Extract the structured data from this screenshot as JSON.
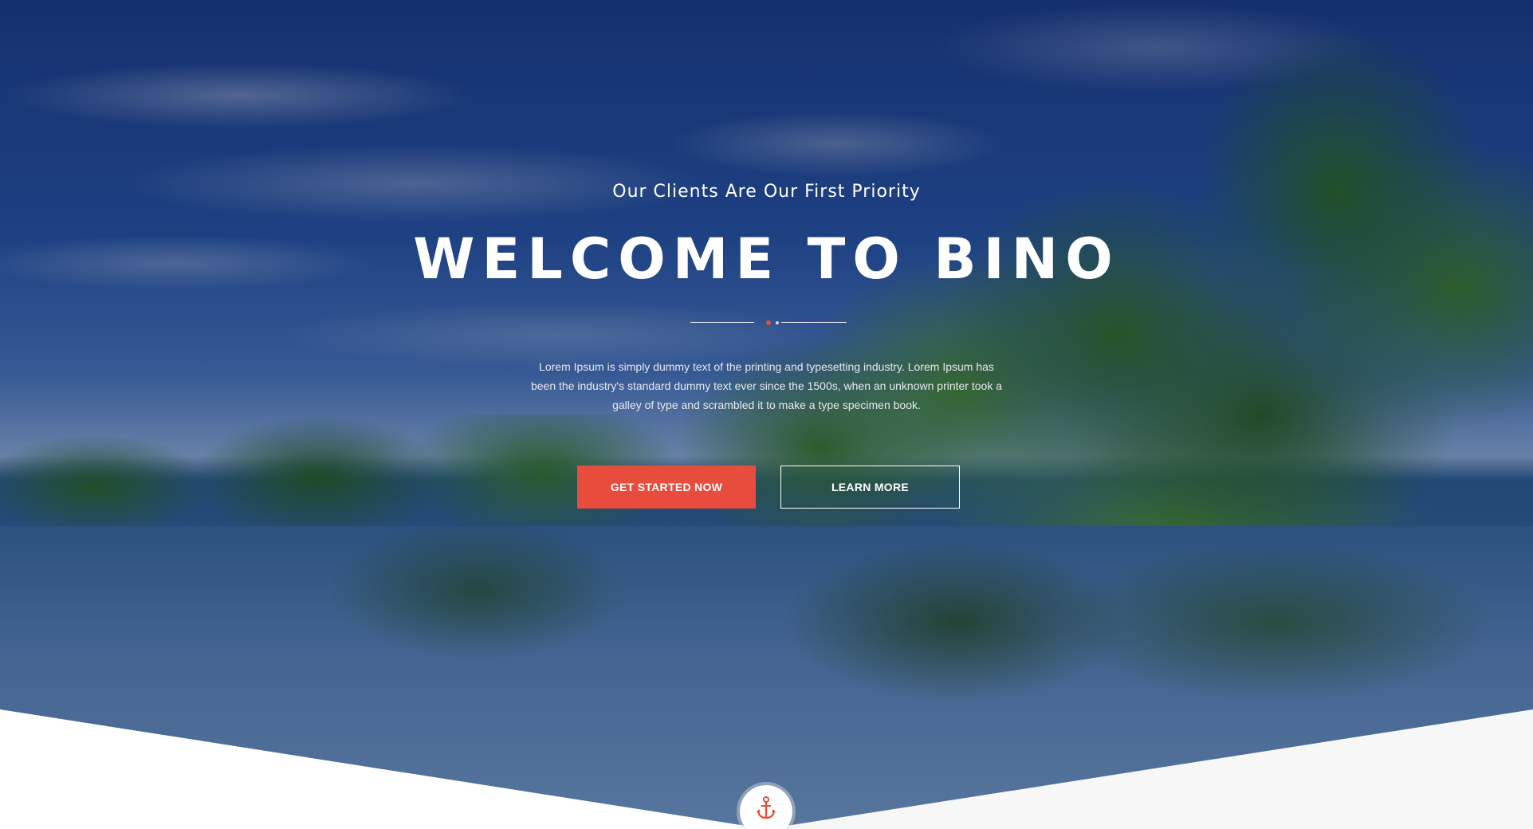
{
  "hero": {
    "subtitle": "Our Clients Are Our First Priority",
    "title": "WELCOME TO BINO",
    "description": "Lorem Ipsum is simply dummy text of the printing and typesetting industry. Lorem Ipsum has been the industry's standard dummy text ever since the 1500s, when an unknown printer took a galley of type and scrambled it to make a type specimen book.",
    "primary_button": "GET STARTED NOW",
    "secondary_button": "LEARN MORE",
    "scroll_icon": "anchor-icon"
  },
  "colors": {
    "accent": "#e74c3c",
    "text": "#ffffff",
    "bottom_shape": "#ffffff",
    "bottom_shape_right": "#f7f7f7"
  }
}
